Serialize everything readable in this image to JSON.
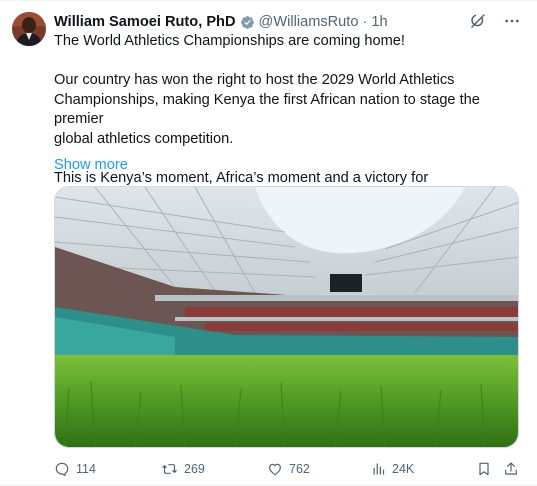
{
  "author": {
    "name": "William Samoei Ruto, PhD",
    "handle": "@WilliamsRuto",
    "separator": "·",
    "time": "1h"
  },
  "tweet": {
    "line1": "The World Athletics Championships are coming home!",
    "para2_line1": "Our country has won the right to host the 2029 World Athletics",
    "para2_line2": "Championships, making Kenya the first African nation to stage the premier",
    "para2_line3": "global athletics competition.",
    "para3_line1": "This is Kenya’s moment, Africa’s moment and a victory for",
    "show_more": "Show more"
  },
  "metrics": {
    "replies": "114",
    "reposts": "269",
    "likes": "762",
    "views": "24K"
  },
  "colors": {
    "accent": "#1d9bf0",
    "verified": "#829aab",
    "text": "#0f1419",
    "muted": "#536471"
  },
  "icons": {
    "top": [
      "grok-icon",
      "more-icon"
    ],
    "actions": [
      "reply-icon",
      "repost-icon",
      "like-icon",
      "views-icon",
      "bookmark-icon",
      "share-icon"
    ]
  }
}
